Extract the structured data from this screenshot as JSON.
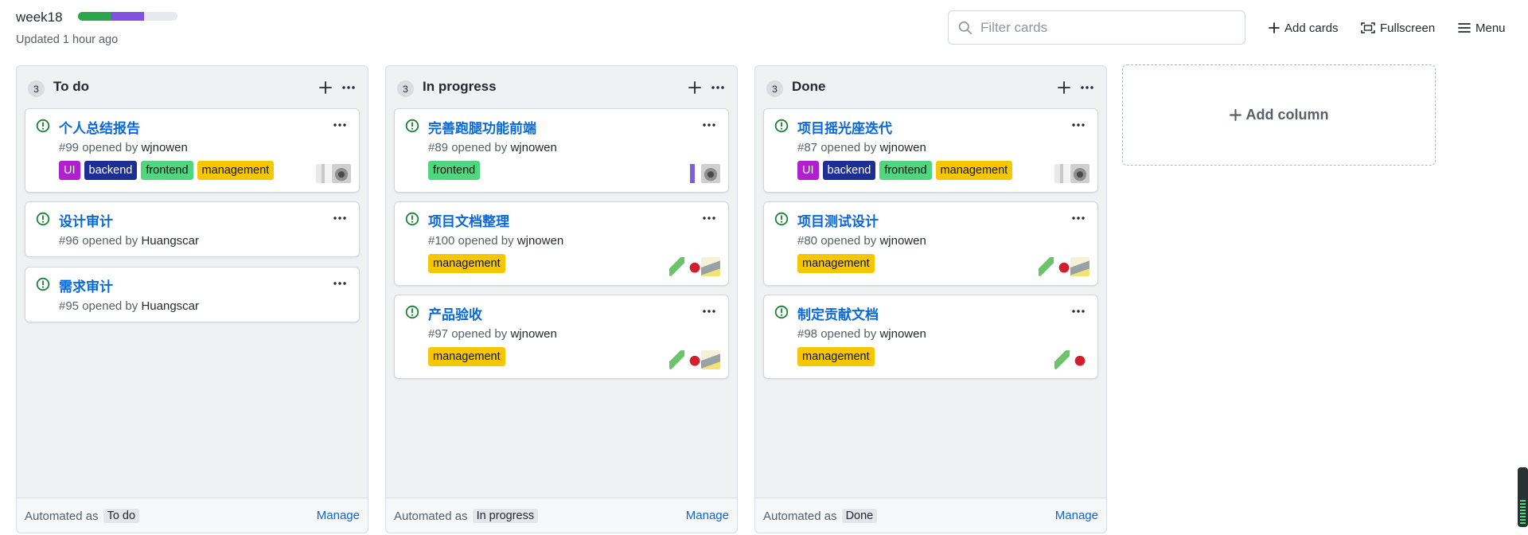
{
  "header": {
    "title": "week18",
    "updated": "Updated 1 hour ago",
    "progress": {
      "done_fraction": 0.33,
      "in_progress_fraction": 0.33
    },
    "filter_placeholder": "Filter cards",
    "add_cards_label": "Add cards",
    "fullscreen_label": "Fullscreen",
    "menu_label": "Menu"
  },
  "columns": [
    {
      "count": "3",
      "name": "To do",
      "automated_prefix": "Automated as",
      "automated_value": "To do",
      "manage_label": "Manage",
      "cards": [
        {
          "title": "个人总结报告",
          "number": "#99",
          "opened_by": "opened by",
          "author": "wjnowen",
          "labels": [
            "UI",
            "backend",
            "frontend",
            "management"
          ],
          "avatars": [
            "raccoon-avatar",
            "gray-avatar"
          ]
        },
        {
          "title": "设计审计",
          "number": "#96",
          "opened_by": "opened by",
          "author": "Huangscar",
          "labels": [],
          "avatars": []
        },
        {
          "title": "需求审计",
          "number": "#95",
          "opened_by": "opened by",
          "author": "Huangscar",
          "labels": [],
          "avatars": []
        }
      ]
    },
    {
      "count": "3",
      "name": "In progress",
      "automated_prefix": "Automated as",
      "automated_value": "In progress",
      "manage_label": "Manage",
      "cards": [
        {
          "title": "完善跑腿功能前端",
          "number": "#89",
          "opened_by": "opened by",
          "author": "wjnowen",
          "labels": [
            "frontend"
          ],
          "avatars": [
            "raccoon-avatar",
            "purple-avatar"
          ]
        },
        {
          "title": "项目文档整理",
          "number": "#100",
          "opened_by": "opened by",
          "author": "wjnowen",
          "labels": [
            "management"
          ],
          "avatars": [
            "cat-avatar",
            "red-avatar",
            "green-avatar"
          ]
        },
        {
          "title": "产品验收",
          "number": "#97",
          "opened_by": "opened by",
          "author": "wjnowen",
          "labels": [
            "management"
          ],
          "avatars": [
            "cat-avatar",
            "red-avatar",
            "green-avatar"
          ]
        }
      ]
    },
    {
      "count": "3",
      "name": "Done",
      "automated_prefix": "Automated as",
      "automated_value": "Done",
      "manage_label": "Manage",
      "cards": [
        {
          "title": "项目摇光座迭代",
          "number": "#87",
          "opened_by": "opened by",
          "author": "wjnowen",
          "labels": [
            "UI",
            "backend",
            "frontend",
            "management"
          ],
          "avatars": [
            "raccoon-avatar",
            "gray-avatar"
          ]
        },
        {
          "title": "项目测试设计",
          "number": "#80",
          "opened_by": "opened by",
          "author": "wjnowen",
          "labels": [
            "management"
          ],
          "avatars": [
            "cat-avatar",
            "red-avatar",
            "green-avatar"
          ]
        },
        {
          "title": "制定贡献文档",
          "number": "#98",
          "opened_by": "opened by",
          "author": "wjnowen",
          "labels": [
            "management"
          ],
          "avatars": [
            "red-avatar",
            "green-avatar"
          ]
        }
      ]
    }
  ],
  "add_column_label": "Add column",
  "colors": {
    "link": "#0969da",
    "open_issue": "#1a7f37",
    "label_ui": "#b01fd0",
    "label_backend": "#1d2f94",
    "label_frontend": "#4fd67e",
    "label_management": "#f6c700"
  }
}
